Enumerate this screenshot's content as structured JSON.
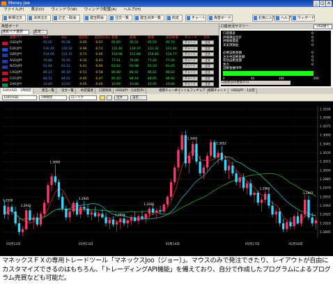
{
  "window": {
    "title": "Money Joe"
  },
  "menu": [
    "ファイル(F)",
    "表示(V)",
    "ウィンドウ(W)",
    "ウィンドウ配置(A)",
    "ヘルプ(H)"
  ],
  "toolbar": [
    "新規注文",
    "決済注文",
    "訂正・取消",
    "建玉照会",
    "注文一覧",
    "建玉決済一覧",
    "約定",
    "チャート",
    "為替ボード",
    "お気に入り",
    "ヘルプ",
    "ウィザード"
  ],
  "rates_panel": {
    "title": "為替ボード",
    "selector": "通貨ペア選択",
    "btn": "設定...",
    "headers": [
      "通貨ペア",
      "Bid",
      "Ask",
      "前日比",
      "前日比(%)",
      "高値",
      "安値",
      "始値",
      "前日終値",
      "チャート",
      "注文"
    ],
    "rows": [
      {
        "pair": "USD/JPY",
        "bid": "95.05",
        "ask": "95.08",
        "chg": "-0.65",
        "chgp": "-0.67",
        "high": "95.85",
        "low": "95.01",
        "open": "95.70",
        "prev": "95.70",
        "color": "#c8102e"
      },
      {
        "pair": "EUR/JPY",
        "bid": "130.44",
        "ask": "130.50",
        "chg": "-0.96",
        "chgp": "-0.73",
        "high": "131.46",
        "low": "130.37",
        "open": "131.32",
        "prev": "131.40",
        "color": "#1e4fc8"
      },
      {
        "pair": "GBP/JPY",
        "bid": "154.06",
        "ask": "154.15",
        "chg": "-0.71",
        "chgp": "-0.46",
        "high": "154.96",
        "low": "153.98",
        "open": "154.80",
        "prev": "154.77",
        "color": "#1e3ca0"
      },
      {
        "pair": "AUD/JPY",
        "bid": "76.88",
        "ask": "76.95",
        "chg": "-0.32",
        "chgp": "-0.41",
        "high": "77.41",
        "low": "76.80",
        "open": "77.26",
        "prev": "77.20",
        "color": "#1e3ca0"
      },
      {
        "pair": "NZD/JPY",
        "bid": "61.04",
        "ask": "61.12",
        "chg": "-0.41",
        "chgp": "-0.66",
        "high": "61.62",
        "low": "60.98",
        "open": "61.50",
        "prev": "61.45",
        "color": "#1e3ca0"
      },
      {
        "pair": "CAD/JPY",
        "bid": "86.11",
        "ask": "86.19",
        "chg": "-0.51",
        "chgp": "-0.58",
        "high": "86.80",
        "low": "86.02",
        "open": "86.62",
        "prev": "86.62",
        "color": "#c8102e"
      },
      {
        "pair": "CHF/JPY",
        "bid": "84.52",
        "ask": "84.61",
        "chg": "-0.40",
        "chgp": "-0.47",
        "high": "85.10",
        "low": "84.44",
        "open": "84.95",
        "prev": "84.92",
        "color": "#c8102e"
      },
      {
        "pair": "ZAR/JPY",
        "bid": "10.89",
        "ask": "10.93",
        "chg": "-0.05",
        "chgp": "-0.46",
        "high": "10.99",
        "low": "10.86",
        "open": "10.95",
        "prev": "10.94",
        "color": "#128a3c"
      }
    ],
    "chart_btn": "チャート",
    "order_btn": "注文"
  },
  "account_panel": {
    "title": "口座状況サマリー",
    "tab": "USD建て",
    "rows": [
      {
        "label": "口座資産",
        "value": "0"
      },
      {
        "label": "評価損益合計",
        "value": "0"
      },
      {
        "label": "評価後資産",
        "value": "0"
      },
      {
        "label": "未実現損益",
        "value": "0"
      },
      {
        "label": "",
        "value": ""
      },
      {
        "label": "必要証拠金額",
        "value": "0"
      },
      {
        "label": "注文中証拠金額",
        "value": "0"
      },
      {
        "label": "有効証拠金額",
        "value": "0"
      },
      {
        "label": "余力",
        "value": "0"
      }
    ],
    "ratio_label": "証拠金維持率",
    "scale": [
      "0",
      "50",
      "100",
      "200"
    ],
    "footer": "口座状況の更新(F5)"
  },
  "chart_tabs": [
    "EUR/USD - 1時間足",
    "建玉一覧",
    "注文一覧",
    "約定履歴",
    "口座残高",
    "USD/JPY - 1分足(R)",
    "相関チャート",
    "ポイント＆フィギュア",
    "相関チャート",
    "USD/JPY - 1分足"
  ],
  "chart_toolbar": {
    "pair": "EUR/USD",
    "period": "1時間足",
    "style": "ローソク",
    "btn_order": "注文",
    "btn_settings": "設定..."
  },
  "chart_data": {
    "type": "candlestick",
    "y_ticks": [
      "1.3104",
      "1.3090",
      "1.3075",
      "1.3060",
      "1.3045",
      "1.3030",
      "1.3015",
      "1.3000",
      "1.2985",
      "1.2970",
      "1.2955",
      "1.2940",
      "1.2925",
      "1.2910",
      "1.2895"
    ],
    "x_ticks": [
      "05月12日",
      "05月13日",
      "05月14日",
      "05月17日",
      "05月18日"
    ],
    "annotations": [
      {
        "label": "1.2939",
        "i": 1
      },
      {
        "label": "1.2932",
        "i": 6
      },
      {
        "label": "1.3008",
        "i": 14
      },
      {
        "label": "1.2945",
        "i": 22
      },
      {
        "label": "1.2919",
        "i": 32
      },
      {
        "label": "1.2936",
        "i": 40
      },
      {
        "label": "1.3065",
        "i": 52
      },
      {
        "label": "1.3052",
        "i": 60
      },
      {
        "label": "1.2965",
        "i": 72
      },
      {
        "label": "1.2957",
        "i": 84
      }
    ],
    "candles": [
      [
        1.294,
        1.295,
        1.2918,
        1.2925
      ],
      [
        1.2925,
        1.2945,
        1.2915,
        1.2938
      ],
      [
        1.2938,
        1.2942,
        1.2925,
        1.293
      ],
      [
        1.293,
        1.2938,
        1.2906,
        1.291
      ],
      [
        1.291,
        1.2918,
        1.289,
        1.2895
      ],
      [
        1.2895,
        1.2905,
        1.2888,
        1.29
      ],
      [
        1.29,
        1.2936,
        1.2898,
        1.2932
      ],
      [
        1.2932,
        1.294,
        1.2912,
        1.2915
      ],
      [
        1.2915,
        1.2925,
        1.29,
        1.292
      ],
      [
        1.292,
        1.2928,
        1.2905,
        1.2908
      ],
      [
        1.2908,
        1.293,
        1.2904,
        1.2926
      ],
      [
        1.2926,
        1.295,
        1.292,
        1.2945
      ],
      [
        1.2945,
        1.298,
        1.294,
        1.2975
      ],
      [
        1.2975,
        1.2995,
        1.2965,
        1.299
      ],
      [
        1.299,
        1.301,
        1.2975,
        1.298
      ],
      [
        1.298,
        1.2985,
        1.295,
        1.2955
      ],
      [
        1.2955,
        1.2962,
        1.293,
        1.2935
      ],
      [
        1.2935,
        1.294,
        1.2915,
        1.292
      ],
      [
        1.292,
        1.2935,
        1.2912,
        1.293
      ],
      [
        1.293,
        1.2948,
        1.2925,
        1.2945
      ],
      [
        1.2945,
        1.295,
        1.2922,
        1.2925
      ],
      [
        1.2925,
        1.294,
        1.2918,
        1.2938
      ],
      [
        1.2938,
        1.2948,
        1.293,
        1.2935
      ],
      [
        1.2935,
        1.2942,
        1.292,
        1.2925
      ],
      [
        1.2925,
        1.2932,
        1.2915,
        1.2928
      ],
      [
        1.2928,
        1.2938,
        1.292,
        1.2922
      ],
      [
        1.2922,
        1.293,
        1.2912,
        1.2926
      ],
      [
        1.2926,
        1.2935,
        1.2918,
        1.292
      ],
      [
        1.292,
        1.2928,
        1.2905,
        1.291
      ],
      [
        1.291,
        1.292,
        1.29,
        1.2916
      ],
      [
        1.2916,
        1.2922,
        1.2904,
        1.2908
      ],
      [
        1.2908,
        1.2915,
        1.2896,
        1.2912
      ],
      [
        1.2912,
        1.292,
        1.29,
        1.2918
      ],
      [
        1.2918,
        1.2925,
        1.2906,
        1.291
      ],
      [
        1.291,
        1.2918,
        1.2902,
        1.2915
      ],
      [
        1.2915,
        1.2924,
        1.2908,
        1.292
      ],
      [
        1.292,
        1.293,
        1.2912,
        1.2914
      ],
      [
        1.2914,
        1.2925,
        1.2908,
        1.2922
      ],
      [
        1.2922,
        1.2932,
        1.2915,
        1.2918
      ],
      [
        1.2918,
        1.2928,
        1.291,
        1.2926
      ],
      [
        1.2926,
        1.2938,
        1.292,
        1.2935
      ],
      [
        1.2935,
        1.2942,
        1.2924,
        1.2928
      ],
      [
        1.2928,
        1.2936,
        1.2918,
        1.2932
      ],
      [
        1.2932,
        1.294,
        1.2925,
        1.293
      ],
      [
        1.293,
        1.2945,
        1.2926,
        1.2942
      ],
      [
        1.2942,
        1.2958,
        1.2938,
        1.2955
      ],
      [
        1.2955,
        1.2985,
        1.295,
        1.298
      ],
      [
        1.298,
        1.301,
        1.2975,
        1.3005
      ],
      [
        1.3005,
        1.304,
        1.2998,
        1.3035
      ],
      [
        1.3035,
        1.3066,
        1.303,
        1.306
      ],
      [
        1.306,
        1.3068,
        1.3005,
        1.3012
      ],
      [
        1.3012,
        1.303,
        1.2995,
        1.3025
      ],
      [
        1.3025,
        1.305,
        1.3018,
        1.3045
      ],
      [
        1.3045,
        1.3052,
        1.301,
        1.3015
      ],
      [
        1.3015,
        1.3025,
        1.299,
        1.2995
      ],
      [
        1.2995,
        1.301,
        1.2985,
        1.3005
      ],
      [
        1.3005,
        1.303,
        1.3,
        1.3025
      ],
      [
        1.3025,
        1.3053,
        1.302,
        1.3048
      ],
      [
        1.3048,
        1.3052,
        1.302,
        1.3022
      ],
      [
        1.3022,
        1.3035,
        1.301,
        1.303
      ],
      [
        1.303,
        1.3042,
        1.3015,
        1.3018
      ],
      [
        1.3018,
        1.3025,
        1.2995,
        1.3
      ],
      [
        1.3,
        1.3012,
        1.2985,
        1.3008
      ],
      [
        1.3008,
        1.3015,
        1.299,
        1.2995
      ],
      [
        1.2995,
        1.3,
        1.2975,
        1.298
      ],
      [
        1.298,
        1.2992,
        1.297,
        1.2988
      ],
      [
        1.2988,
        1.2995,
        1.2965,
        1.297
      ],
      [
        1.297,
        1.2982,
        1.296,
        1.2978
      ],
      [
        1.2978,
        1.2985,
        1.2955,
        1.2958
      ],
      [
        1.2958,
        1.2966,
        1.2945,
        1.2962
      ],
      [
        1.2962,
        1.2966,
        1.294,
        1.2945
      ],
      [
        1.2945,
        1.2955,
        1.293,
        1.295
      ],
      [
        1.295,
        1.2965,
        1.2944,
        1.296
      ],
      [
        1.296,
        1.2968,
        1.2935,
        1.294
      ],
      [
        1.294,
        1.2948,
        1.292,
        1.2925
      ],
      [
        1.2925,
        1.2935,
        1.291,
        1.293
      ],
      [
        1.293,
        1.2936,
        1.2905,
        1.291
      ],
      [
        1.291,
        1.2918,
        1.2895,
        1.29
      ],
      [
        1.29,
        1.2915,
        1.2895,
        1.2912
      ],
      [
        1.2912,
        1.292,
        1.29,
        1.2905
      ],
      [
        1.2905,
        1.2925,
        1.29,
        1.2922
      ],
      [
        1.2922,
        1.293,
        1.2908,
        1.291
      ],
      [
        1.291,
        1.2928,
        1.2905,
        1.2925
      ],
      [
        1.2925,
        1.2958,
        1.292,
        1.295
      ],
      [
        1.295,
        1.2957,
        1.2915,
        1.292
      ],
      [
        1.292,
        1.2928,
        1.2905,
        1.291
      ],
      [
        1.291,
        1.292,
        1.29,
        1.2915
      ]
    ]
  },
  "caption": "マネックスＦＸの専用トレードツール「マネックスJoo（ジョー）」。マウスのみで発注できたり、レイアウトが自由にカスタマイズできるのはもちろん、「トレーディングAPI機能」を備えており、自分で作成したプログラムによるプログラム売買なども可能だ。"
}
